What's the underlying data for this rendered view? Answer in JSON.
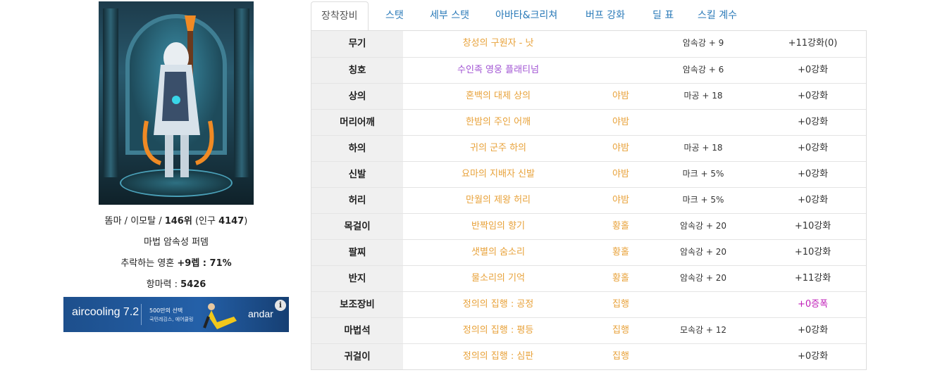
{
  "character": {
    "line1_prefix": "똠마 / 이모탈 / ",
    "line1_rank": "146위",
    "line1_pop_prefix": " (인구 ",
    "line1_pop": "4147",
    "line1_pop_suffix": ")",
    "job": "마법 암속성 퍼뎀",
    "soul_prefix": "추락하는 영혼 ",
    "soul_value": "+9렙 : 71%",
    "resist_prefix": "항마력 : ",
    "resist_value": "5426"
  },
  "ad": {
    "brand": "aircooling 7.2",
    "copy1": "500만의 선택",
    "copy2": "국민레깅스, 에어쿨링",
    "advertiser": "andar",
    "info_icon": "i"
  },
  "tabs": [
    {
      "label": "장착장비",
      "active": true
    },
    {
      "label": "스탯"
    },
    {
      "label": "세부 스탯"
    },
    {
      "label": "아바타&크리쳐"
    },
    {
      "label": "버프 강화"
    },
    {
      "label": "딜 표"
    },
    {
      "label": "스킬 계수"
    }
  ],
  "equipment": [
    {
      "slot": "무기",
      "item": "창성의 구원자 - 낫",
      "set": "",
      "stat": "암속강 + 9",
      "enhance": "+11강화(0)"
    },
    {
      "slot": "칭호",
      "item": "수인족 영웅 플래티넘",
      "set": "",
      "stat": "암속강 + 6",
      "enhance": "+0강화"
    },
    {
      "slot": "상의",
      "item": "혼백의 대제 상의",
      "set": "야밤",
      "stat": "마공 + 18",
      "enhance": "+0강화"
    },
    {
      "slot": "머리어깨",
      "item": "한밤의 주인 어깨",
      "set": "야밤",
      "stat": "",
      "enhance": "+0강화"
    },
    {
      "slot": "하의",
      "item": "귀의 군주 하의",
      "set": "야밤",
      "stat": "마공 + 18",
      "enhance": "+0강화"
    },
    {
      "slot": "신발",
      "item": "요마의 지배자 신발",
      "set": "야밤",
      "stat": "마크 + 5%",
      "enhance": "+0강화"
    },
    {
      "slot": "허리",
      "item": "만월의 제왕 허리",
      "set": "야밤",
      "stat": "마크 + 5%",
      "enhance": "+0강화"
    },
    {
      "slot": "목걸이",
      "item": "반짝임의 향기",
      "set": "황홀",
      "stat": "암속강 + 20",
      "enhance": "+10강화"
    },
    {
      "slot": "팔찌",
      "item": "샛별의 숨소리",
      "set": "황홀",
      "stat": "암속강 + 20",
      "enhance": "+10강화"
    },
    {
      "slot": "반지",
      "item": "물소리의 기억",
      "set": "황홀",
      "stat": "암속강 + 20",
      "enhance": "+11강화"
    },
    {
      "slot": "보조장비",
      "item": "정의의 집행 : 공정",
      "set": "집행",
      "stat": "",
      "enhance": "+0증폭"
    },
    {
      "slot": "마법석",
      "item": "정의의 집행 : 평등",
      "set": "집행",
      "stat": "모속강 + 12",
      "enhance": "+0강화"
    },
    {
      "slot": "귀걸이",
      "item": "정의의 집행 : 심판",
      "set": "집행",
      "stat": "",
      "enhance": "+0강화"
    }
  ],
  "colors": {
    "epic_item": "#e8a23a",
    "title_item": "#a154d3",
    "amplify": "#c020b8",
    "tab_link": "#2a7ab8"
  }
}
